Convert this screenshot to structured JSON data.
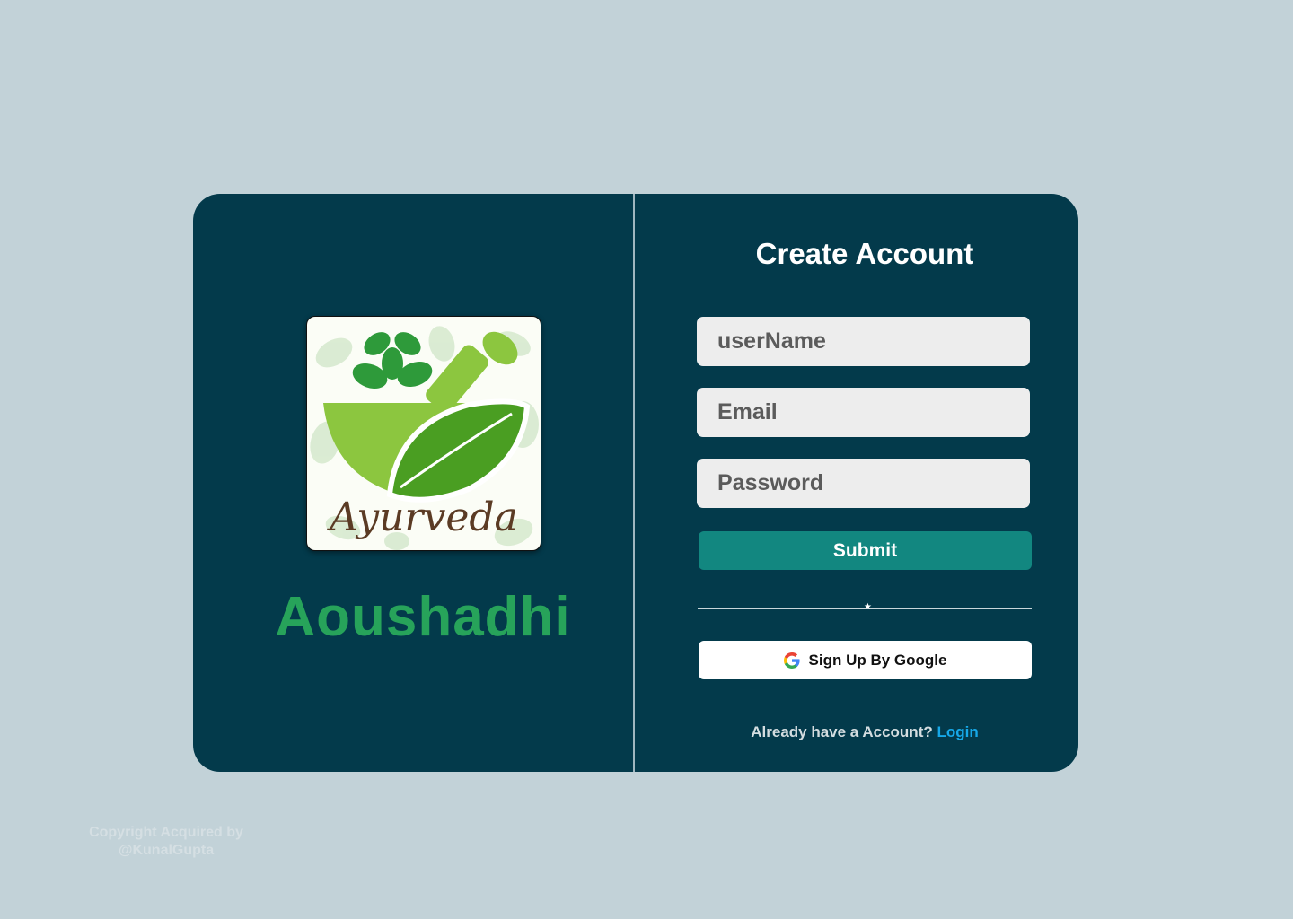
{
  "brand": {
    "logo_text": "Ayurveda",
    "name": "Aoushadhi"
  },
  "form": {
    "title": "Create Account",
    "username_placeholder": "userName",
    "email_placeholder": "Email",
    "password_placeholder": "Password",
    "submit_label": "Submit",
    "google_label": "Sign Up By Google",
    "account_prompt": "Already have a Account?",
    "login_link": "Login"
  },
  "copyright": {
    "line1": "Copyright Acquired by",
    "line2": "@KunalGupta"
  },
  "colors": {
    "background": "#c2d2d8",
    "card": "#033a4b",
    "brand_green": "#27a35a",
    "submit": "#128780",
    "link": "#16a8e8"
  },
  "icons": {
    "google": "google-g-icon",
    "logo": "mortar-pestle-leaf-logo"
  }
}
